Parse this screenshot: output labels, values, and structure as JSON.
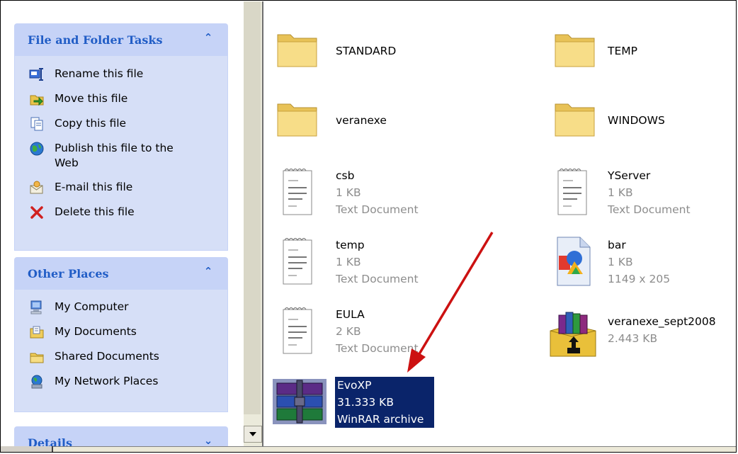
{
  "task_pane": {
    "file_folder_tasks": {
      "title": "File and Folder Tasks",
      "collapse_glyph": "⌃",
      "items": [
        {
          "label": "Rename this file",
          "icon": "rename-icon"
        },
        {
          "label": "Move this file",
          "icon": "move-icon"
        },
        {
          "label": "Copy this file",
          "icon": "copy-icon"
        },
        {
          "label": "Publish this file to the",
          "label2": "Web",
          "icon": "publish-web-icon"
        },
        {
          "label": "E-mail this file",
          "icon": "email-icon"
        },
        {
          "label": "Delete this file",
          "icon": "delete-icon"
        }
      ]
    },
    "other_places": {
      "title": "Other Places",
      "collapse_glyph": "⌃",
      "items": [
        {
          "label": "My Computer",
          "icon": "my-computer-icon"
        },
        {
          "label": "My Documents",
          "icon": "my-documents-icon"
        },
        {
          "label": "Shared Documents",
          "icon": "shared-documents-icon"
        },
        {
          "label": "My Network Places",
          "icon": "network-places-icon"
        }
      ]
    },
    "details": {
      "title": "Details",
      "expand_glyph": "⌄"
    }
  },
  "files": [
    {
      "name": "STANDARD",
      "type": "folder"
    },
    {
      "name": "TEMP",
      "type": "folder"
    },
    {
      "name": "veranexe",
      "type": "folder"
    },
    {
      "name": "WINDOWS",
      "type": "folder"
    },
    {
      "name": "csb",
      "size": "1 KB",
      "kind": "Text Document",
      "type": "text"
    },
    {
      "name": "YServer",
      "size": "1 KB",
      "kind": "Text Document",
      "type": "text"
    },
    {
      "name": "temp",
      "size": "1 KB",
      "kind": "Text Document",
      "type": "text"
    },
    {
      "name": "bar",
      "size": "1 KB",
      "kind": "1149 x 205",
      "type": "image"
    },
    {
      "name": "EULA",
      "size": "2 KB",
      "kind": "Text Document",
      "type": "text"
    },
    {
      "name": "veranexe_sept2008",
      "size": "2.443 KB",
      "type": "winrar-sfx"
    },
    {
      "name": "EvoXP",
      "size": "31.333 KB",
      "kind": "WinRAR archive",
      "type": "winrar",
      "selected": true
    }
  ],
  "colors": {
    "selection": "#0a246a",
    "panel_header": "#c6d3f7",
    "panel_body": "#d6dff7",
    "panel_title": "#215dc6",
    "annotation_arrow": "#cc1111"
  }
}
